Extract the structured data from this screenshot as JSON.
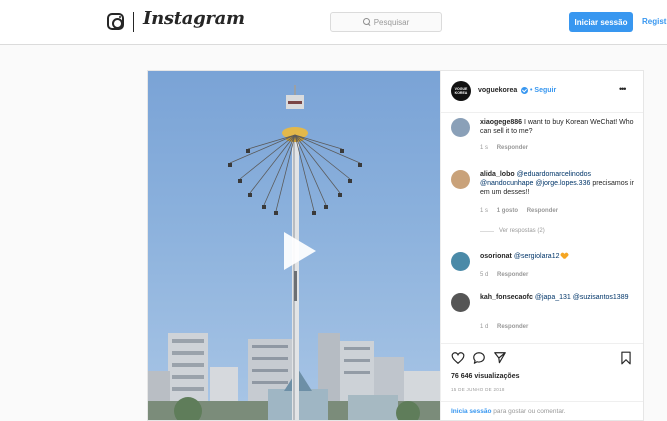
{
  "header": {
    "brand": "Instagram",
    "search_placeholder": "Pesquisar",
    "login_button": "Iniciar sessão",
    "register_link": "Regist"
  },
  "post": {
    "author": {
      "avatar_text": "VOGUE KOREA",
      "username": "voguekorea",
      "separator": "•",
      "follow_label": "Seguir"
    },
    "comments": [
      {
        "username": "xiaogege886",
        "text": "I want to buy Korean WeChat! Who can sell it to me?",
        "time": "1 s",
        "reply_label": "Responder",
        "avatar_color": "#8aa0b8"
      },
      {
        "username": "alida_lobo",
        "mentions": "@eduardomarcelinodos @nandocunhape @jorge.lopes.336",
        "text": "precisamos ir em um desses!!",
        "time": "1 s",
        "likes": "1 gosto",
        "reply_label": "Responder",
        "view_replies": "Ver respostas (2)",
        "avatar_color": "#c9a27a"
      },
      {
        "username": "osorionat",
        "mentions": "@sergiolara12",
        "emoji": "heart-orange",
        "time": "5 d",
        "reply_label": "Responder",
        "avatar_color": "#4a8aa8"
      },
      {
        "username": "kah_fonsecaofc",
        "mentions": "@japa_131 @suzisantos1389",
        "time": "1 d",
        "reply_label": "Responder",
        "avatar_color": "#555555"
      }
    ],
    "views": "76 646 visualizações",
    "date": "15 DE JUNHO DE 2018",
    "login_prompt": {
      "link": "Inicia sessão",
      "text": "para gostar ou comentar."
    }
  },
  "icons": {
    "like": "heart-outline-icon",
    "comment": "comment-bubble-icon",
    "share": "paper-plane-icon",
    "save": "bookmark-icon",
    "play": "play-icon"
  },
  "colors": {
    "accent": "#3897f0",
    "mention": "#003569",
    "muted": "#999999"
  }
}
